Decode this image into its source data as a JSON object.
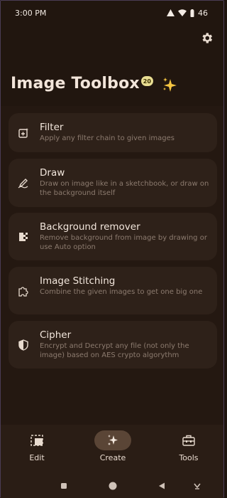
{
  "status_bar": {
    "time": "3:00 PM",
    "battery": "46"
  },
  "app": {
    "title": "Image Toolbox",
    "version_badge": "20"
  },
  "tools": [
    {
      "title": "Filter",
      "description": "Apply any filter chain to given images",
      "icon": "filter-icon"
    },
    {
      "title": "Draw",
      "description": "Draw on image like in a sketchbook, or draw on the background itself",
      "icon": "draw-icon"
    },
    {
      "title": "Background remover",
      "description": "Remove background from image by drawing or use Auto option",
      "icon": "background-remover-icon"
    },
    {
      "title": "Image Stitching",
      "description": "Combine the given images to get one big one",
      "icon": "puzzle-icon"
    },
    {
      "title": "Cipher",
      "description": "Encrypt and Decrypt any file (not only the image) based on AES crypto algorythm",
      "icon": "shield-icon"
    }
  ],
  "bottom_nav": [
    {
      "label": "Edit",
      "icon": "edit-icon",
      "active": false
    },
    {
      "label": "Create",
      "icon": "sparkles-icon",
      "active": true
    },
    {
      "label": "Tools",
      "icon": "toolbox-icon",
      "active": false
    }
  ],
  "colors": {
    "background": "#21160f",
    "card": "#2e2119",
    "badge": "#e9dd92",
    "sparkle": "#f5c542",
    "active_nav": "#5a4536"
  }
}
